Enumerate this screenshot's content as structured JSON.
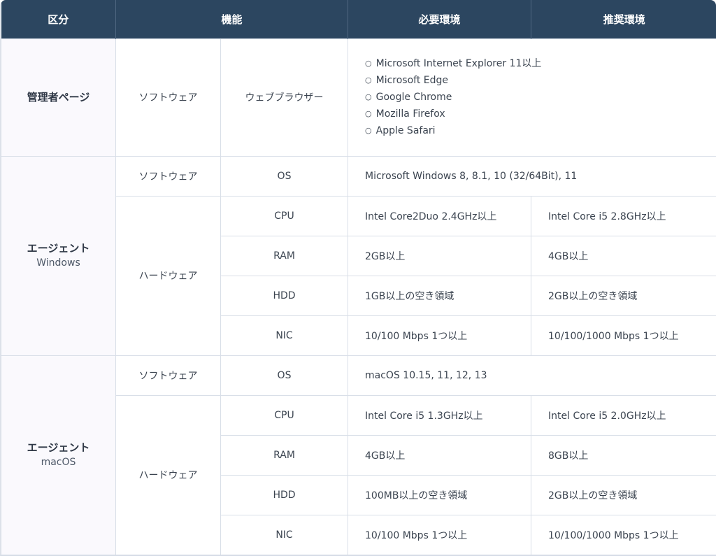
{
  "header": {
    "col1": "区分",
    "col2": "機能",
    "col3": "必要環境",
    "col4": "推奨環境"
  },
  "admin": {
    "category": "管理者ページ",
    "type": "ソフトウェア",
    "feature": "ウェブブラウザー",
    "browsers": [
      "Microsoft Internet Explorer 11以上",
      "Microsoft Edge",
      "Google Chrome",
      "Mozilla Firefox",
      "Apple Safari"
    ]
  },
  "windows": {
    "category": "エージェント",
    "subcategory": "Windows",
    "software": "ソフトウェア",
    "hardware": "ハードウェア",
    "os": {
      "label": "OS",
      "required": "Microsoft Windows 8, 8.1, 10 (32/64Bit), 11"
    },
    "cpu": {
      "label": "CPU",
      "required": "Intel Core2Duo 2.4GHz以上",
      "recommended": "Intel Core i5 2.8GHz以上"
    },
    "ram": {
      "label": "RAM",
      "required": "2GB以上",
      "recommended": "4GB以上"
    },
    "hdd": {
      "label": "HDD",
      "required": "1GB以上の空き領域",
      "recommended": "2GB以上の空き領域"
    },
    "nic": {
      "label": "NIC",
      "required": "10/100 Mbps 1つ以上",
      "recommended": "10/100/1000 Mbps 1つ以上"
    }
  },
  "macos": {
    "category": "エージェント",
    "subcategory": "macOS",
    "software": "ソフトウェア",
    "hardware": "ハードウェア",
    "os": {
      "label": "OS",
      "required": "macOS 10.15, 11, 12, 13"
    },
    "cpu": {
      "label": "CPU",
      "required": "Intel Core i5 1.3GHz以上",
      "recommended": "Intel Core i5 2.0GHz以上"
    },
    "ram": {
      "label": "RAM",
      "required": "4GB以上",
      "recommended": "8GB以上"
    },
    "hdd": {
      "label": "HDD",
      "required": "100MB以上の空き領域",
      "recommended": "2GB以上の空き領域"
    },
    "nic": {
      "label": "NIC",
      "required": "10/100 Mbps 1つ以上",
      "recommended": "10/100/1000 Mbps 1つ以上"
    }
  },
  "colors": {
    "header_bg": "#2c4660",
    "category_bg": "#faf9fd",
    "border": "#d9dfe8"
  }
}
